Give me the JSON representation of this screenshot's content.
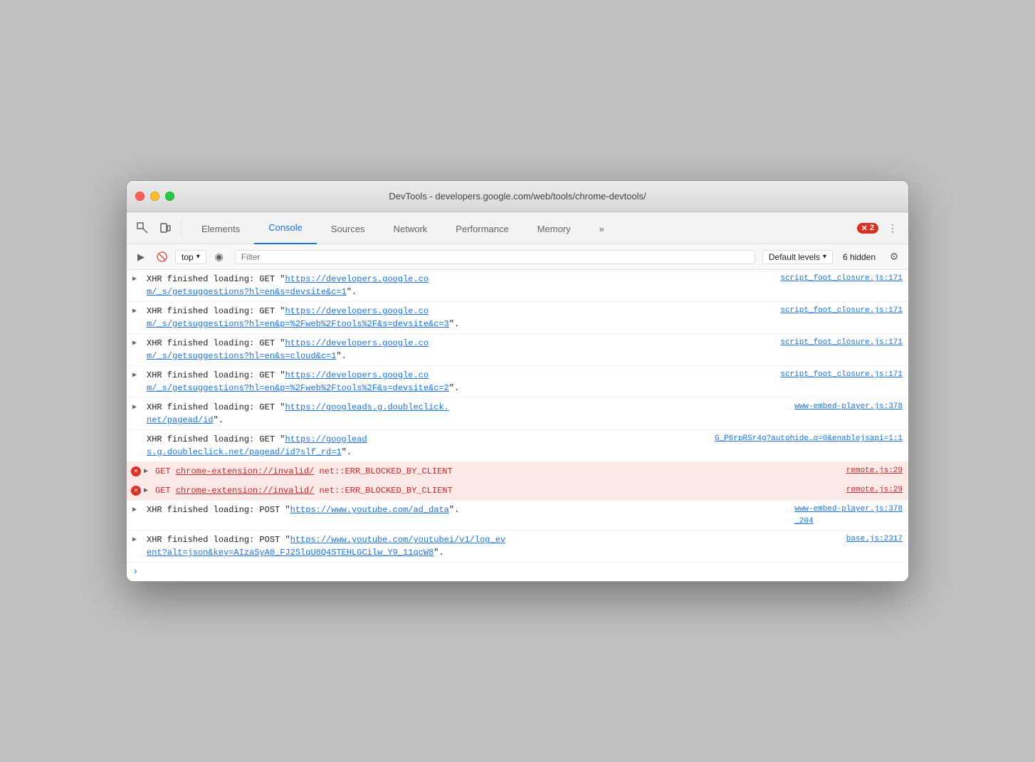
{
  "window": {
    "title": "DevTools - developers.google.com/web/tools/chrome-devtools/"
  },
  "traffic_lights": {
    "close": "close",
    "minimize": "minimize",
    "maximize": "maximize"
  },
  "tabs": {
    "items": [
      {
        "id": "elements",
        "label": "Elements",
        "active": false
      },
      {
        "id": "console",
        "label": "Console",
        "active": true
      },
      {
        "id": "sources",
        "label": "Sources",
        "active": false
      },
      {
        "id": "network",
        "label": "Network",
        "active": false
      },
      {
        "id": "performance",
        "label": "Performance",
        "active": false
      },
      {
        "id": "memory",
        "label": "Memory",
        "active": false
      }
    ],
    "more_label": "»",
    "error_count": "2",
    "menu_icon": "⋮"
  },
  "console_toolbar": {
    "play_label": "▶",
    "block_label": "🚫",
    "context_value": "top",
    "context_arrow": "▾",
    "eye_label": "◉",
    "filter_placeholder": "Filter",
    "levels_label": "Default levels",
    "levels_arrow": "▾",
    "hidden_label": "6 hidden",
    "settings_label": "⚙"
  },
  "log_entries": [
    {
      "id": 1,
      "type": "info",
      "expand": "▶",
      "text": "XHR finished loading: GET \"",
      "link_text": "https://developers.google.co\nm/_s/getsuggestions?hl=en&s=devsite&c=1",
      "link_url": "https://developers.google.com/_s/getsuggestions?hl=en&s=devsite&c=1",
      "suffix": "\".",
      "source": "script_foot_closure.js:171",
      "source_url": "script_foot_closure.js:171"
    },
    {
      "id": 2,
      "type": "info",
      "expand": "▶",
      "text": "XHR finished loading: GET \"",
      "link_text": "https://developers.google.co\nm/_s/getsuggestions?hl=en&p=%2Fweb%2Ftools%2F&s=devsite&c=3",
      "link_url": "https://developers.google.com/_s/getsuggestions?hl=en&p=%2Fweb%2Ftools%2F&s=devsite&c=3",
      "suffix": "\".",
      "source": "script_foot_closure.js:171",
      "source_url": "script_foot_closure.js:171"
    },
    {
      "id": 3,
      "type": "info",
      "expand": "▶",
      "text": "XHR finished loading: GET \"",
      "link_text": "https://developers.google.co\nm/_s/getsuggestions?hl=en&s=cloud&c=1",
      "link_url": "https://developers.google.com/_s/getsuggestions?hl=en&s=cloud&c=1",
      "suffix": "\".",
      "source": "script_foot_closure.js:171",
      "source_url": "script_foot_closure.js:171"
    },
    {
      "id": 4,
      "type": "info",
      "expand": "▶",
      "text": "XHR finished loading: GET \"",
      "link_text": "https://developers.google.co\nm/_s/getsuggestions?hl=en&p=%2Fweb%2Ftools%2F&s=devsite&c=2",
      "link_url": "https://developers.google.com/_s/getsuggestions?hl=en&p=%2Fweb%2Ftools%2F&s=devsite&c=2",
      "suffix": "\".",
      "source": "script_foot_closure.js:171",
      "source_url": "script_foot_closure.js:171"
    },
    {
      "id": 5,
      "type": "info",
      "expand": "▶",
      "text": "XHR finished loading: GET \"",
      "link_text": "https://googleads.g.doubleclick.\nnet/pagead/id",
      "link_url": "https://googleads.g.doubleclick.net/pagead/id",
      "suffix": "\".",
      "source": "www-embed-player.js:378",
      "source_url": "www-embed-player.js:378"
    },
    {
      "id": 6,
      "type": "info",
      "expand": null,
      "text": "XHR finished loading: GET \"",
      "link_text": "https://googlead\ns.g.doubleclick.net/pagead/id?slf_rd=1",
      "link_url": "https://googleads.g.doubleclick.net/pagead/id?slf_rd=1",
      "suffix": "\".",
      "source": "G_P6rpRSr4g?autohide…o=0&enablejsapi=1:1",
      "source_url": "G_P6rpRSr4g?autohide=0&enablejsapi=1"
    },
    {
      "id": 7,
      "type": "error",
      "expand": "▶",
      "text": "GET ",
      "link_text": "chrome-extension://invalid/",
      "error_text": " net::ERR_BLOCKED_BY_CLIENT",
      "source": "remote.js:29",
      "source_url": "remote.js:29"
    },
    {
      "id": 8,
      "type": "error",
      "expand": "▶",
      "text": "GET ",
      "link_text": "chrome-extension://invalid/",
      "error_text": " net::ERR_BLOCKED_BY_CLIENT",
      "source": "remote.js:29",
      "source_url": "remote.js:29"
    },
    {
      "id": 9,
      "type": "info",
      "expand": "▶",
      "text": "XHR finished loading: POST \"",
      "link_text": "https://www.youtube.com/ad_data",
      "link_url": "https://www.youtube.com/ad_data",
      "suffix": "\".",
      "source": "www-embed-player.js:378\n_204",
      "source_url": "www-embed-player.js:378"
    },
    {
      "id": 10,
      "type": "info",
      "expand": "▶",
      "text": "XHR finished loading: POST \"",
      "link_text": "https://www.youtube.com/youtubei/v1/log_ev\nent?alt=json&key=AIzaSyA0_FJ2SlqU8Q4STEHLGCilw_Y9_11qcW8",
      "link_url": "https://www.youtube.com/youtubei/v1/log_event?alt=json&key=AIzaSyA0_FJ2SlqU8Q4STEHLGCilw_Y9_11qcW8",
      "suffix": "\".",
      "source": "base.js:2317",
      "source_url": "base.js:2317"
    }
  ],
  "prompt": {
    "arrow": "›"
  }
}
